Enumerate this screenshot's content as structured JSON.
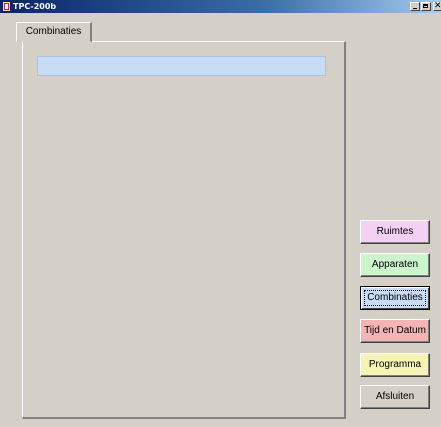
{
  "window": {
    "title": "TPC-200b",
    "controls": [
      "minimize",
      "maximize",
      "close"
    ],
    "close_glyph": "✕"
  },
  "tabs": [
    {
      "label": "Combinaties",
      "active": true
    }
  ],
  "combinations_list": {
    "items": []
  },
  "buttons": [
    {
      "id": "ruimtes",
      "label": "Ruimtes",
      "color": "#f4d0f4"
    },
    {
      "id": "apparaten",
      "label": "Apparaten",
      "color": "#ccf5cc"
    },
    {
      "id": "combinaties",
      "label": "Combinaties",
      "color": "#c8dcf5",
      "focused": true
    },
    {
      "id": "tijd",
      "label": "Tijd en Datum",
      "color": "#f5b4b4"
    },
    {
      "id": "programma",
      "label": "Programma",
      "color": "#f8f5b4"
    },
    {
      "id": "afsluiten",
      "label": "Afsluiten",
      "color": "#d4d0c8"
    }
  ],
  "colors": {
    "dialog_bg": "#d4d0c8",
    "titlebar_start": "#0a246a",
    "titlebar_end": "#a6caf0",
    "list_selection": "#c8dcf5"
  },
  "icons": {
    "app": "app-icon",
    "minimize": "minimize-icon",
    "maximize": "maximize-icon",
    "close": "close-icon"
  }
}
